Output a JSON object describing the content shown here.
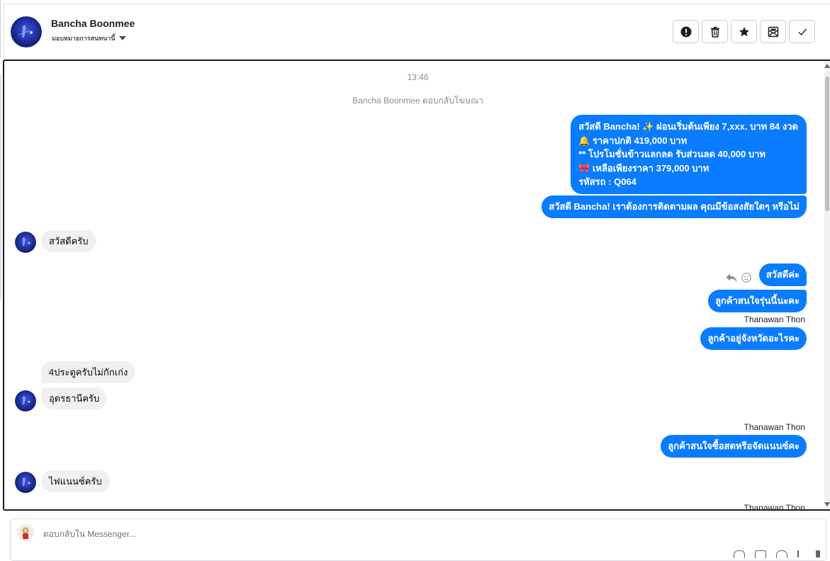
{
  "header": {
    "contact_name": "Bancha Boonmee",
    "assign_label": "มอบหมายการสนทนานี้",
    "actions": [
      {
        "name": "mark-spam-button",
        "icon": "exclamation-circle-icon"
      },
      {
        "name": "delete-button",
        "icon": "trash-icon"
      },
      {
        "name": "star-button",
        "icon": "star-icon"
      },
      {
        "name": "mark-unread-button",
        "icon": "envelope-icon"
      },
      {
        "name": "mark-done-button",
        "icon": "check-icon"
      }
    ]
  },
  "chat": {
    "timestamp": "13:46",
    "system_note": "Bancha Boonmee ตอบกลับโฆษณา",
    "promo_message": {
      "line1": "สวัสดี Bancha! ✨  ผ่อนเริ่มต้นเพียง 7,xxx. บาท 84 งวด",
      "line2": "🔔 ราคาปกติ 419,000 บาท",
      "line3": "** โปรโมชั่นข้าวแลกลด รับส่วนลด 40,000 บาท",
      "line4": "🎀  เหลือเพียงราคา 379,000 บาท",
      "line5": " รหัสรถ : Q064"
    },
    "followup_message": "สวัสดี Bancha! เราต้องการติดตามผล คุณมีข้อสงสัยใดๆ หรือไม่",
    "in_1": "สวัสดีครับ",
    "out_1": "สวัสดีค่ะ",
    "out_2": "ลูกค้าสนใจรุ่นนี้นะคะ",
    "sender_1": "Thanawan Thon",
    "out_3": "ลูกค้าอยู่จังหวัดอะไรคะ",
    "in_2": "4ประตูครับไม่กักเก่ง",
    "in_3": "อุดรธานีครับ",
    "sender_2": "Thanawan Thon",
    "out_4": "ลูกค้าสนใจซื้อสดหรือจัดแนนซ์คะ",
    "in_4": "ไฟแนนซ์ครับ",
    "sender_3": "Thanawan Thon"
  },
  "composer": {
    "placeholder": "ตอบกลับใน Messenger...",
    "tools": [
      "attach-icon",
      "image-icon",
      "emoji-icon",
      "tag-icon",
      "send-icon"
    ]
  },
  "colors": {
    "outgoing_bubble": "#0a7cff",
    "incoming_bubble": "#f0f0f0",
    "frame_border": "#1c1e21"
  }
}
